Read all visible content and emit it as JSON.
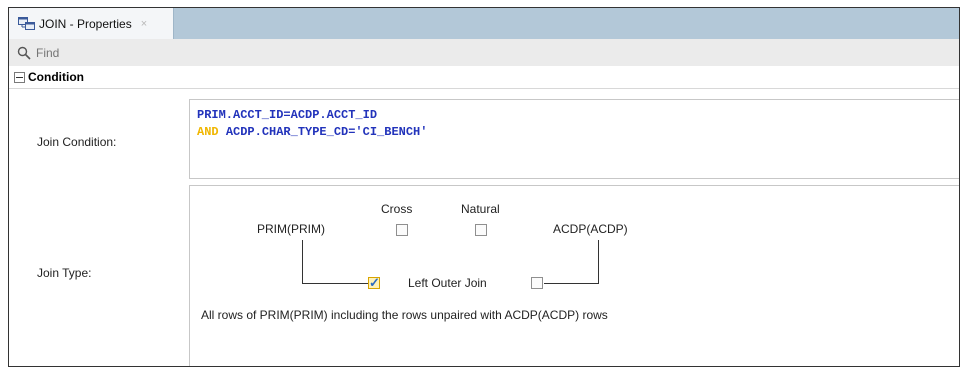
{
  "tab": {
    "title": "JOIN - Properties",
    "close": "×",
    "icon": "join-properties-icon"
  },
  "find": {
    "placeholder": "Find",
    "icon": "search-icon"
  },
  "section": {
    "title": "Condition",
    "icon": "collapse-icon"
  },
  "join_condition": {
    "label": "Join Condition:",
    "lines": [
      {
        "keyword": "",
        "text": "PRIM.ACCT_ID=ACDP.ACCT_ID"
      },
      {
        "keyword": "AND",
        "text": "ACDP.CHAR_TYPE_CD='CI_BENCH'"
      }
    ]
  },
  "join_type": {
    "label": "Join Type:",
    "left_table": "PRIM(PRIM)",
    "right_table": "ACDP(ACDP)",
    "cross": {
      "label": "Cross",
      "checked": false
    },
    "natural": {
      "label": "Natural",
      "checked": false
    },
    "left_outer_checked": true,
    "right_outer_checked": false,
    "outer_label": "Left Outer Join",
    "description": "All rows of PRIM(PRIM) including the rows unpaired with ACDP(ACDP) rows"
  },
  "colors": {
    "keyword": "#f0b600",
    "code_text": "#2233bb",
    "tab_strip": "#b3c8d8"
  }
}
